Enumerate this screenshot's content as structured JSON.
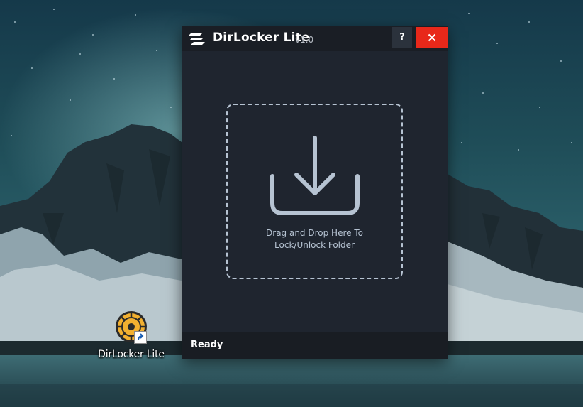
{
  "desktop": {
    "shortcut_label": "DirLocker Lite"
  },
  "window": {
    "title": "DirLocker Lite",
    "version": "v1.0",
    "help_label": "?",
    "close_label": "✕",
    "drop_text_line1": "Drag and Drop Here To",
    "drop_text_line2": "Lock/Unlock Folder",
    "status": "Ready"
  },
  "colors": {
    "close_button": "#e8281a",
    "window_bg": "#1f252f",
    "titlebar_bg": "#1a1e25",
    "dropzone_border": "#b6c3d2",
    "shortcut_icon": "#f2b030"
  },
  "icons": {
    "app_logo": "layers-logo-icon",
    "drop_icon": "download-tray-icon",
    "close": "close-icon",
    "shortcut": "dirlocker-app-icon",
    "shortcut_overlay": "shortcut-arrow-icon"
  }
}
